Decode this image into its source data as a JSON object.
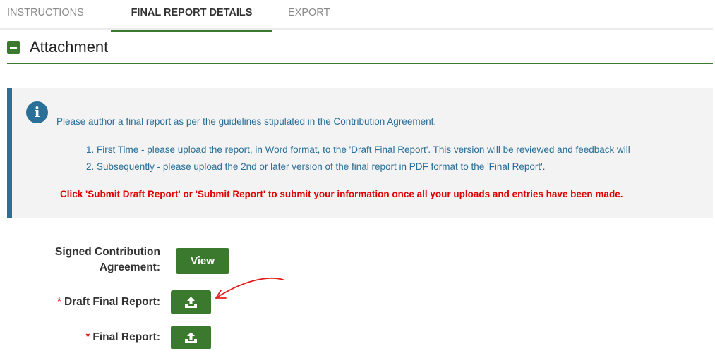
{
  "tabs": [
    {
      "label": "INSTRUCTIONS"
    },
    {
      "label": "FINAL REPORT DETAILS"
    },
    {
      "label": "EXPORT"
    }
  ],
  "section": {
    "title": "Attachment"
  },
  "info": {
    "icon": "info-icon",
    "line1": "Please author a final report as per the guidelines stipulated in the Contribution Agreement.",
    "line2": "1. First Time - please upload the report, in Word format, to the 'Draft Final Report'. This version will be reviewed and feedback will",
    "line3": "2. Subsequently - please upload the 2nd or later version of the final report in PDF format to the 'Final Report'.",
    "warning": "Click 'Submit Draft Report' or 'Submit Report' to submit your information once all your uploads and entries have been made."
  },
  "fields": {
    "signed": {
      "label_line1": "Signed Contribution",
      "label_line2": "Agreement:",
      "button": "View"
    },
    "draft": {
      "required": "*",
      "label": "Draft Final Report:"
    },
    "final": {
      "required": "*",
      "label": "Final Report:"
    }
  },
  "colors": {
    "accent": "#3b7a2e",
    "info": "#2a6f97",
    "warning": "#e00000"
  }
}
